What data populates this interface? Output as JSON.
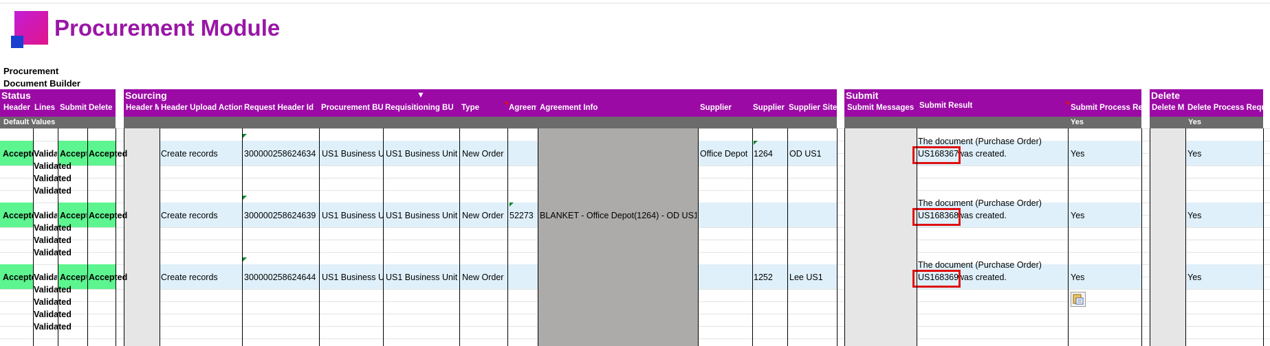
{
  "app_title": "Procurement Module",
  "subtitle": [
    "Procurement",
    "Document Builder"
  ],
  "sections": {
    "status": "Status",
    "sourcing": "Sourcing",
    "submit": "Submit",
    "delete": "Delete"
  },
  "columns": {
    "status": [
      "Header",
      "Lines",
      "Submit",
      "Delete"
    ],
    "sourcing": [
      "Header M",
      "Header Upload Action",
      "Request Header Id",
      "Procurement BU",
      "Requisitioning BU",
      "Type",
      "Agreem",
      "Agreement Info",
      "Supplier",
      "Supplier",
      "Supplier Site"
    ],
    "submit": [
      "Submit Messages",
      "Submit Result",
      "Submit Process Re"
    ],
    "delete": [
      "Delete M",
      "Delete Process Requ"
    ]
  },
  "defaults": {
    "label": "Default Values",
    "submit_process": "Yes",
    "delete_process": "Yes"
  },
  "rows": [
    {
      "status": [
        "Accepted",
        "Valida",
        "Accept",
        "Accepted"
      ],
      "lines_validated": [
        "Validated",
        "Validated",
        "Validated"
      ],
      "upload_action": "Create records",
      "request_header_id": "300000258624634",
      "procurement_bu": "US1 Business Un",
      "requisitioning_bu": "US1 Business Unit",
      "type": "New Order",
      "agreement": "",
      "agreement_info": "",
      "supplier": "Office Depot",
      "supplier_num": "1264",
      "supplier_site": "OD US1",
      "submit_result_line1": "The document (Purchase Order)",
      "submit_result_doc": "US168367",
      "submit_result_line2": " was created.",
      "submit_process": "Yes",
      "delete_process": "Yes"
    },
    {
      "status": [
        "Accepted",
        "Valida",
        "Accept",
        "Accepted"
      ],
      "lines_validated": [
        "Validated",
        "Validated",
        "Validated"
      ],
      "upload_action": "Create records",
      "request_header_id": "300000258624639",
      "procurement_bu": "US1 Business Un",
      "requisitioning_bu": "US1 Business Unit",
      "type": "New Order",
      "agreement": "52273",
      "agreement_info": "BLANKET - Office Depot(1264) - OD US1",
      "supplier": "",
      "supplier_num": "",
      "supplier_site": "",
      "submit_result_line1": "The document (Purchase Order)",
      "submit_result_doc": "US168368",
      "submit_result_line2": " was created.",
      "submit_process": "Yes",
      "delete_process": "Yes"
    },
    {
      "status": [
        "Accepted",
        "Valida",
        "Accept",
        "Accepted"
      ],
      "lines_validated": [
        "Validated",
        "Validated",
        "Validated",
        "Validated"
      ],
      "upload_action": "Create records",
      "request_header_id": "300000258624644",
      "procurement_bu": "US1 Business Un",
      "requisitioning_bu": "US1 Business Unit",
      "type": "New Order",
      "agreement": "",
      "agreement_info": "",
      "supplier": "",
      "supplier_num": "1252",
      "supplier_site": "Lee US1",
      "submit_result_line1": "The document (Purchase Order)",
      "submit_result_doc": "US168369",
      "submit_result_line2": " was created.",
      "submit_process": "Yes",
      "delete_process": "Yes"
    }
  ],
  "colors": {
    "accent": "#9c0aa6",
    "title": "#9a16a6",
    "accepted": "#5cf58f",
    "highlight": "#e01010"
  },
  "icons": [
    "logo-icon",
    "filter-arrow-icon",
    "paste-options-icon"
  ]
}
